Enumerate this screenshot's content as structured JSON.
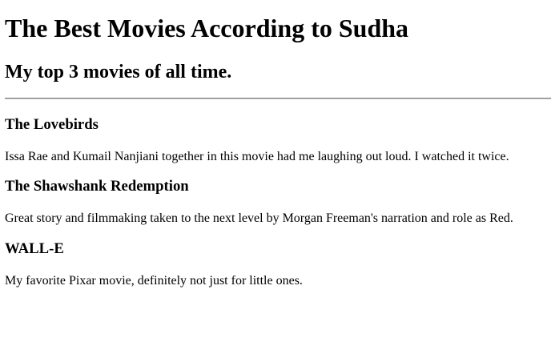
{
  "header": {
    "title": "The Best Movies According to Sudha",
    "subtitle": "My top 3 movies of all time."
  },
  "movies": [
    {
      "title": "The Lovebirds",
      "description": "Issa Rae and Kumail Nanjiani together in this movie had me laughing out loud. I watched it twice."
    },
    {
      "title": "The Shawshank Redemption",
      "description": "Great story and filmmaking taken to the next level by Morgan Freeman's narration and role as Red."
    },
    {
      "title": "WALL-E",
      "description": "My favorite Pixar movie, definitely not just for little ones."
    }
  ]
}
